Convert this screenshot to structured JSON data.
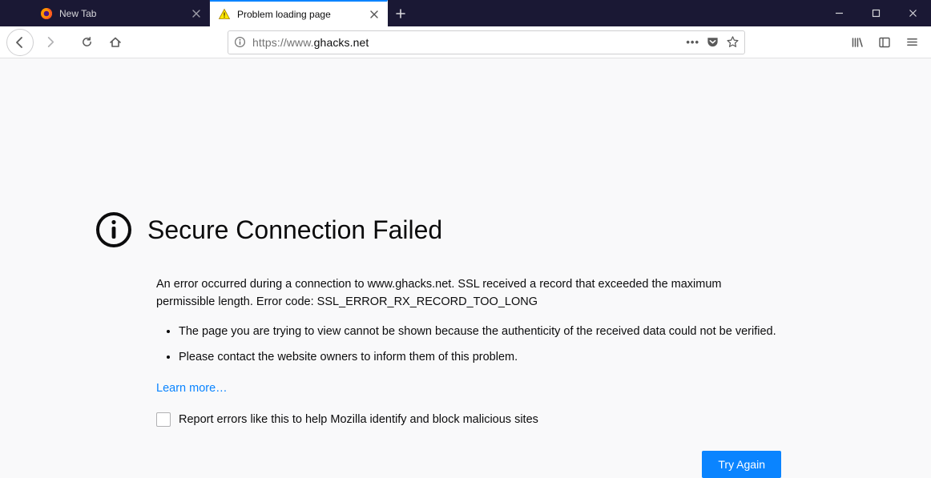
{
  "tabs": [
    {
      "label": "New Tab",
      "active": false
    },
    {
      "label": "Problem loading page",
      "active": true
    }
  ],
  "urlbar": {
    "prefix": "https://www.",
    "domain": "ghacks.net",
    "suffix": ""
  },
  "error": {
    "title": "Secure Connection Failed",
    "description": "An error occurred during a connection to www.ghacks.net. SSL received a record that exceeded the maximum permissible length. Error code: SSL_ERROR_RX_RECORD_TOO_LONG",
    "bullets": [
      "The page you are trying to view cannot be shown because the authenticity of the received data could not be verified.",
      "Please contact the website owners to inform them of this problem."
    ],
    "learn_more": "Learn more…",
    "report_label": "Report errors like this to help Mozilla identify and block malicious sites",
    "try_again": "Try Again"
  }
}
